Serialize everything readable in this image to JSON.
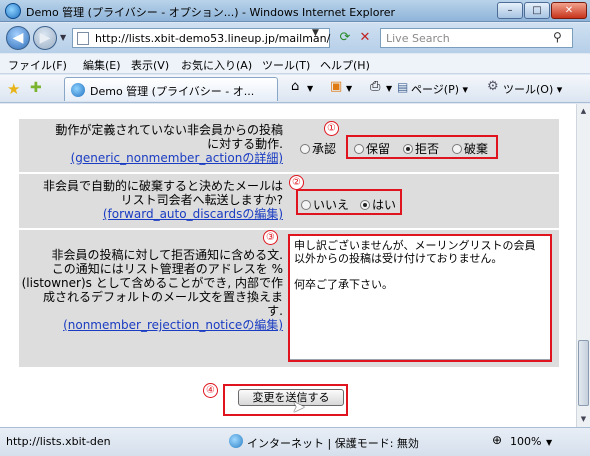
{
  "window": {
    "title": "Demo 管理 (プライバシー - オプション...) - Windows Internet Explorer",
    "min_label": "–",
    "max_label": "□",
    "close_label": "✕"
  },
  "address": {
    "url": "http://lists.xbit-demo53.lineup.jp/mailman/",
    "search_placeholder": "Live Search"
  },
  "menu": [
    "ファイル(F)",
    "編集(E)",
    "表示(V)",
    "お気に入り(A)",
    "ツール(T)",
    "ヘルプ(H)"
  ],
  "tab": {
    "label": "Demo 管理 (プライバシー - オ..."
  },
  "commands": {
    "page": "ページ(P) ▾",
    "tools": "ツール(O) ▾"
  },
  "settings": {
    "row1": {
      "label_line1": "動作が定義されていない非会員からの投稿",
      "label_line2": "に対する動作.",
      "link": "(generic_nonmember_actionの詳細)",
      "options": [
        "承認",
        "保留",
        "拒否",
        "破棄"
      ],
      "selected": "拒否",
      "marker": "①"
    },
    "row2": {
      "label_line1": "非会員で自動的に破棄すると決めたメールは",
      "label_line2": "リスト司会者へ転送しますか?",
      "link": "(forward_auto_discardsの編集)",
      "options": [
        "いいえ",
        "はい"
      ],
      "selected": "はい",
      "marker": "②"
    },
    "row3": {
      "label_line1": "非会員の投稿に対して拒否通知に含める文.",
      "label_line2": "この通知にはリスト管理者のアドレスを %",
      "label_line3": "(listowner)s として含めることができ, 内部で作",
      "label_line4": "成されるデフォルトのメール文を置き換えま",
      "label_line5": "す.",
      "link": "(nonmember_rejection_noticeの編集)",
      "textarea_value": "申し訳ございませんが、メーリングリストの会員以外からの投稿は受け付けておりません。\n\n何卒ご了承下さい。",
      "marker": "③"
    },
    "submit": {
      "label": "変更を送信する",
      "marker": "④"
    }
  },
  "status": {
    "url": "http://lists.xbit-den",
    "zone": "インターネット | 保護モード: 無効",
    "zoom": "100%"
  }
}
